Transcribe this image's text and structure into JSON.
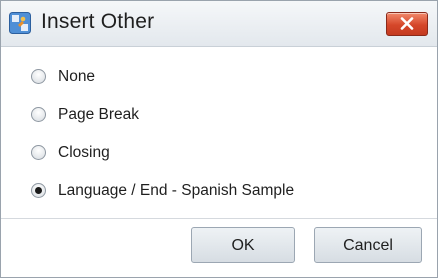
{
  "window": {
    "title": "Insert Other",
    "icon": "insert-component-icon",
    "close_icon": "close-icon"
  },
  "options": [
    {
      "label": "None",
      "selected": false
    },
    {
      "label": "Page Break",
      "selected": false
    },
    {
      "label": "Closing",
      "selected": false
    },
    {
      "label": "Language / End - Spanish Sample",
      "selected": true
    }
  ],
  "buttons": {
    "ok_label": "OK",
    "cancel_label": "Cancel"
  },
  "colors": {
    "close_button": "#d5472a",
    "titlebar": "#e3e8ed",
    "button_face": "#dfe4e9"
  }
}
